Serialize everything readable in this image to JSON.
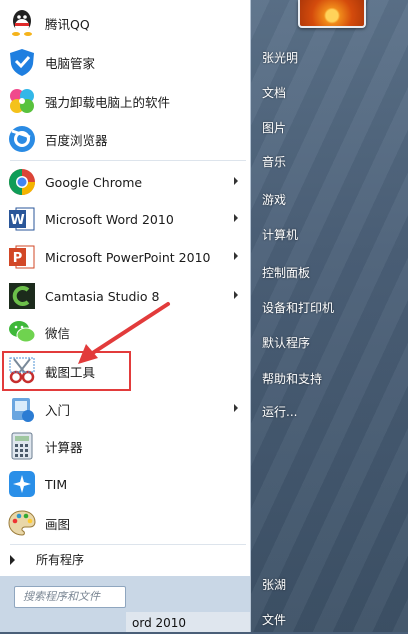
{
  "programs": [
    {
      "label": "腾讯QQ",
      "icon": "qq-icon",
      "arrow": false
    },
    {
      "label": "电脑管家",
      "icon": "shield-icon",
      "arrow": false
    },
    {
      "label": "强力卸载电脑上的软件",
      "icon": "pinwheel-icon",
      "arrow": false
    },
    {
      "label": "百度浏览器",
      "icon": "browser-icon",
      "arrow": false
    },
    {
      "label": "Google Chrome",
      "icon": "chrome-icon",
      "arrow": true
    },
    {
      "label": "Microsoft Word 2010",
      "icon": "word-icon",
      "arrow": true
    },
    {
      "label": "Microsoft PowerPoint 2010",
      "icon": "powerpoint-icon",
      "arrow": true
    },
    {
      "label": "Camtasia Studio 8",
      "icon": "camtasia-icon",
      "arrow": true
    },
    {
      "label": "微信",
      "icon": "wechat-icon",
      "arrow": false
    },
    {
      "label": "截图工具",
      "icon": "scissors-icon",
      "arrow": false
    },
    {
      "label": "入门",
      "icon": "getting-started-icon",
      "arrow": true
    },
    {
      "label": "计算器",
      "icon": "calculator-icon",
      "arrow": false
    },
    {
      "label": "TIM",
      "icon": "tim-icon",
      "arrow": false
    },
    {
      "label": "画图",
      "icon": "paint-icon",
      "arrow": false
    }
  ],
  "all_programs_label": "所有程序",
  "search": {
    "placeholder": "搜索程序和文件"
  },
  "right_menu": [
    {
      "label": "张光明",
      "arrow": false
    },
    {
      "label": "文档",
      "arrow": false
    },
    {
      "label": "图片",
      "arrow": false
    },
    {
      "label": "音乐",
      "arrow": false
    },
    {
      "label": "游戏",
      "arrow": false
    },
    {
      "label": "计算机",
      "arrow": false
    },
    {
      "label": "控制面板",
      "arrow": false
    },
    {
      "label": "设备和打印机",
      "arrow": false
    },
    {
      "label": "默认程序",
      "arrow": false
    },
    {
      "label": "帮助和支持",
      "arrow": false
    },
    {
      "label": "运行...",
      "arrow": false
    },
    {
      "label": "张湖",
      "arrow": false
    },
    {
      "label": "文件",
      "arrow": false
    }
  ],
  "taskbar_text": "ord 2010",
  "colors": {
    "highlight": "#e23b3b",
    "panel": "#4b6078"
  }
}
